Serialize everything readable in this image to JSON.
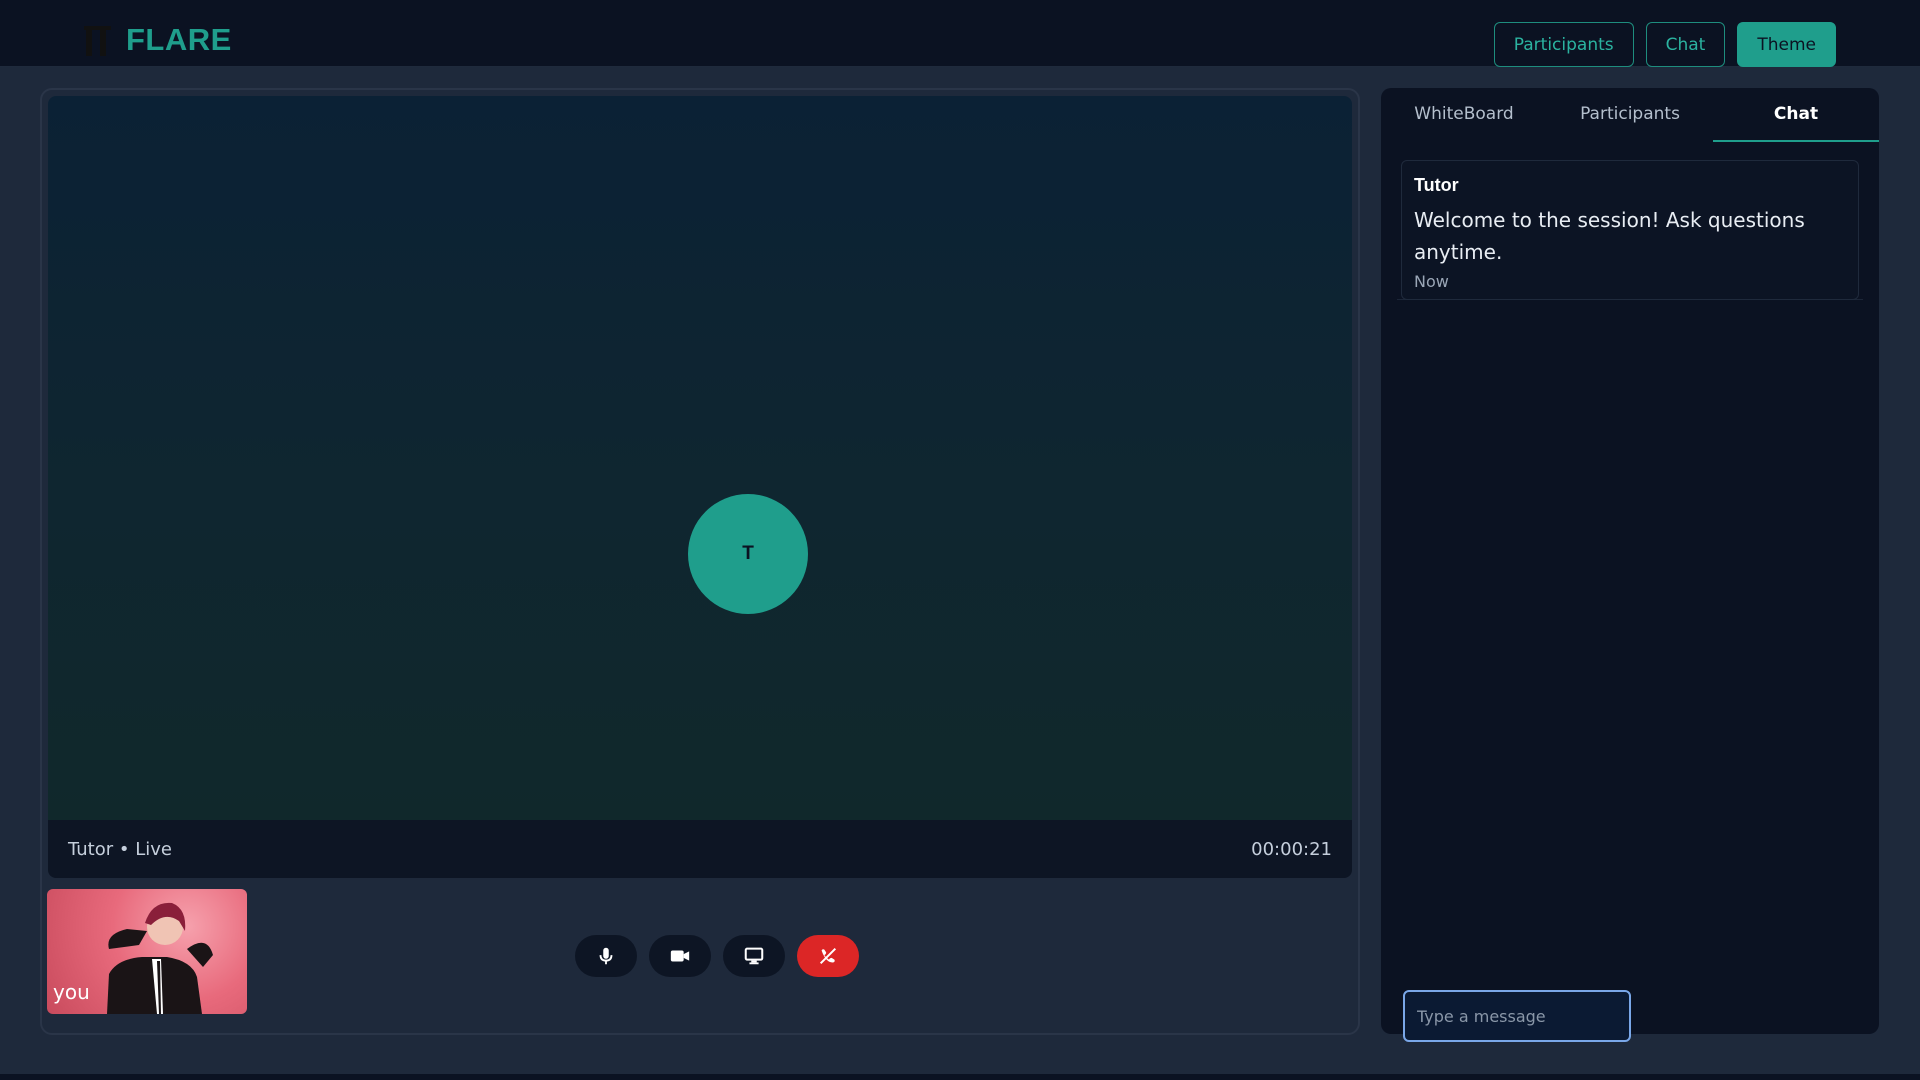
{
  "app": {
    "name": "FLARE"
  },
  "header": {
    "buttons": [
      "Participants",
      "Chat",
      "Theme"
    ]
  },
  "stage": {
    "avatar_initial": "T",
    "live_label": "Tutor • Live",
    "timer": "00:00:21",
    "self_label": "you"
  },
  "controls": {
    "icons": [
      "microphone-icon",
      "camera-icon",
      "screen-share-icon",
      "end-call-icon"
    ],
    "end_color": "#dc2626"
  },
  "sidebar": {
    "tabs": [
      "WhiteBoard",
      "Participants",
      "Chat"
    ],
    "active_tab": "Chat",
    "messages": [
      {
        "author": "Tutor",
        "text": "Welcome to the session! Ask questions anytime.",
        "time": "Now"
      }
    ],
    "input_placeholder": "Type a message"
  },
  "colors": {
    "accent": "#1f9e8c",
    "background": "#1e293b",
    "panel": "#0b1222"
  }
}
